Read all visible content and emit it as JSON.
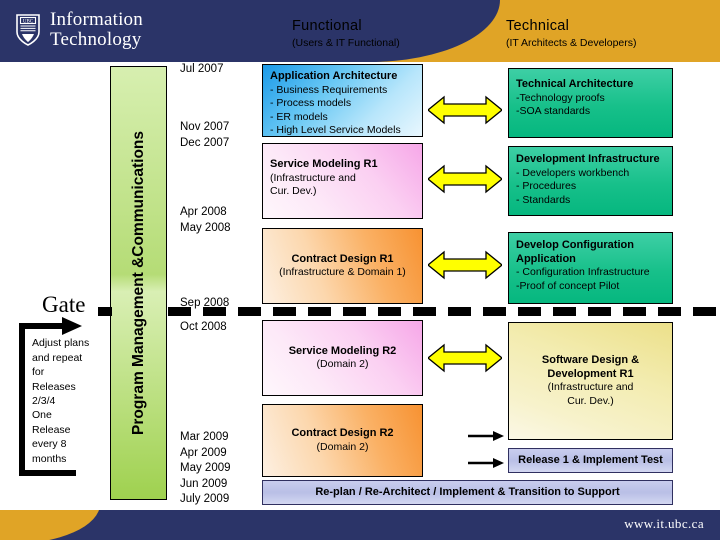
{
  "header": {
    "logo_line1": "Information",
    "logo_line2": "Technology",
    "crest_icon": "ubc-shield-icon",
    "columns": [
      {
        "title": "Functional",
        "subtitle": "(Users & IT Functional)"
      },
      {
        "title": "Technical",
        "subtitle": "(IT Architects & Developers)"
      }
    ]
  },
  "footer": {
    "url": "www.it.ubc.ca"
  },
  "swimlane": {
    "label": "Program Management &Communications"
  },
  "timeline": {
    "group1": "Jul 2007",
    "group2": "Nov 2007\nDec 2007",
    "group3": "Apr 2008\nMay 2008",
    "group4": "Sep 2008",
    "group5": "Oct 2008",
    "group6": "Mar 2009\nApr 2009\nMay 2009\nJun 2009\nJuly 2009"
  },
  "gate": {
    "label": "Gate",
    "note1": "Adjust plans\nand repeat\nfor\nReleases\n2/3/4",
    "note2": "One\nRelease\nevery 8\nmonths"
  },
  "functional_boxes": [
    {
      "title": "Application Architecture",
      "lines": [
        "- Business Requirements",
        "- Process models",
        "- ER models",
        "- High Level Service Models"
      ],
      "color": "#1b9ae8"
    },
    {
      "title": "Service Modeling R1",
      "lines": [
        "(Infrastructure and",
        "Cur. Dev.)"
      ],
      "color": "#f6a7e8"
    },
    {
      "title": "Contract Design R1",
      "lines": [
        "(Infrastructure & Domain 1)"
      ],
      "color": "#f79232"
    },
    {
      "title": "Service Modeling R2",
      "lines": [
        "(Domain 2)"
      ],
      "color": "#f6a7e8"
    },
    {
      "title": "Contract Design R2",
      "lines": [
        "(Domain 2)"
      ],
      "color": "#f79232"
    }
  ],
  "technical_boxes": [
    {
      "title": "Technical Architecture",
      "lines": [
        "-Technology proofs",
        "-SOA standards"
      ],
      "color": "#17c08a"
    },
    {
      "title": "Development Infrastructure",
      "lines": [
        "- Developers workbench",
        "- Procedures",
        "- Standards"
      ],
      "color": "#17c08a"
    },
    {
      "title": "Develop Configuration",
      "title2": "Application",
      "lines": [
        "- Configuration Infrastructure",
        "-Proof of concept Pilot"
      ],
      "color": "#17c08a"
    },
    {
      "title": "Software Design &",
      "title2": "Development R1",
      "lines": [
        "(Infrastructure and",
        "Cur. Dev.)"
      ],
      "color": "#ece08a"
    },
    {
      "title": "Release 1 & Implement Test",
      "lines": [],
      "color": "#c9cdee"
    }
  ],
  "bottom_bar": {
    "label": "Re-plan / Re-Architect / Implement & Transition to Support"
  },
  "connectors": {
    "double_arrow_icon": "double-headed-arrow-icon",
    "arrow_icon": "right-arrow-icon",
    "double_arrow_color": "#ffff00",
    "loop_icon": "feedback-loop-arrow-icon"
  }
}
